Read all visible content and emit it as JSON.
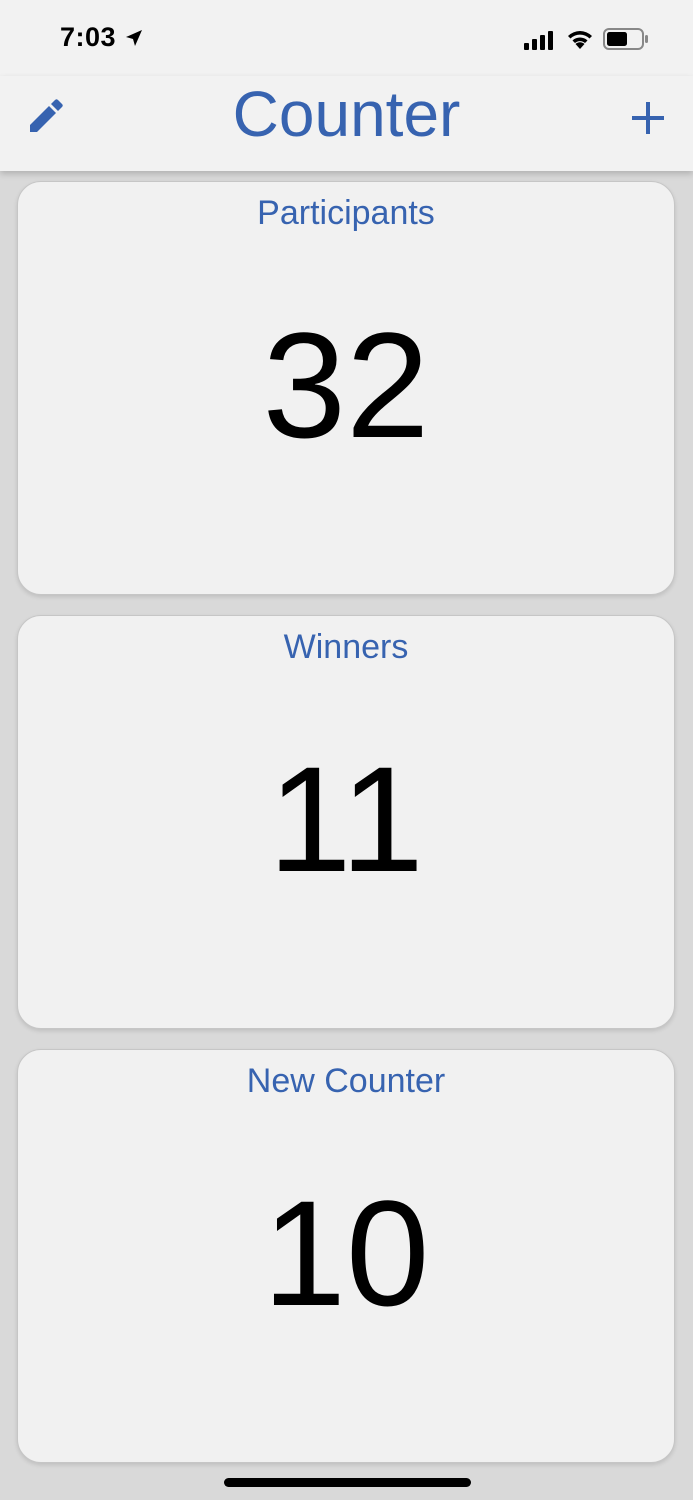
{
  "status_bar": {
    "time": "7:03",
    "icons": [
      "location-arrow-icon",
      "cellular-signal-icon",
      "wifi-icon",
      "battery-icon"
    ]
  },
  "nav": {
    "title": "Counter",
    "left_icon": "pencil-icon",
    "right_icon": "plus-icon"
  },
  "colors": {
    "accent": "#3763b0",
    "background": "#d9d9d9",
    "card": "#f1f1f1"
  },
  "counters": [
    {
      "label": "Participants",
      "value": "32"
    },
    {
      "label": "Winners",
      "value": "11"
    },
    {
      "label": "New Counter",
      "value": "10"
    }
  ]
}
